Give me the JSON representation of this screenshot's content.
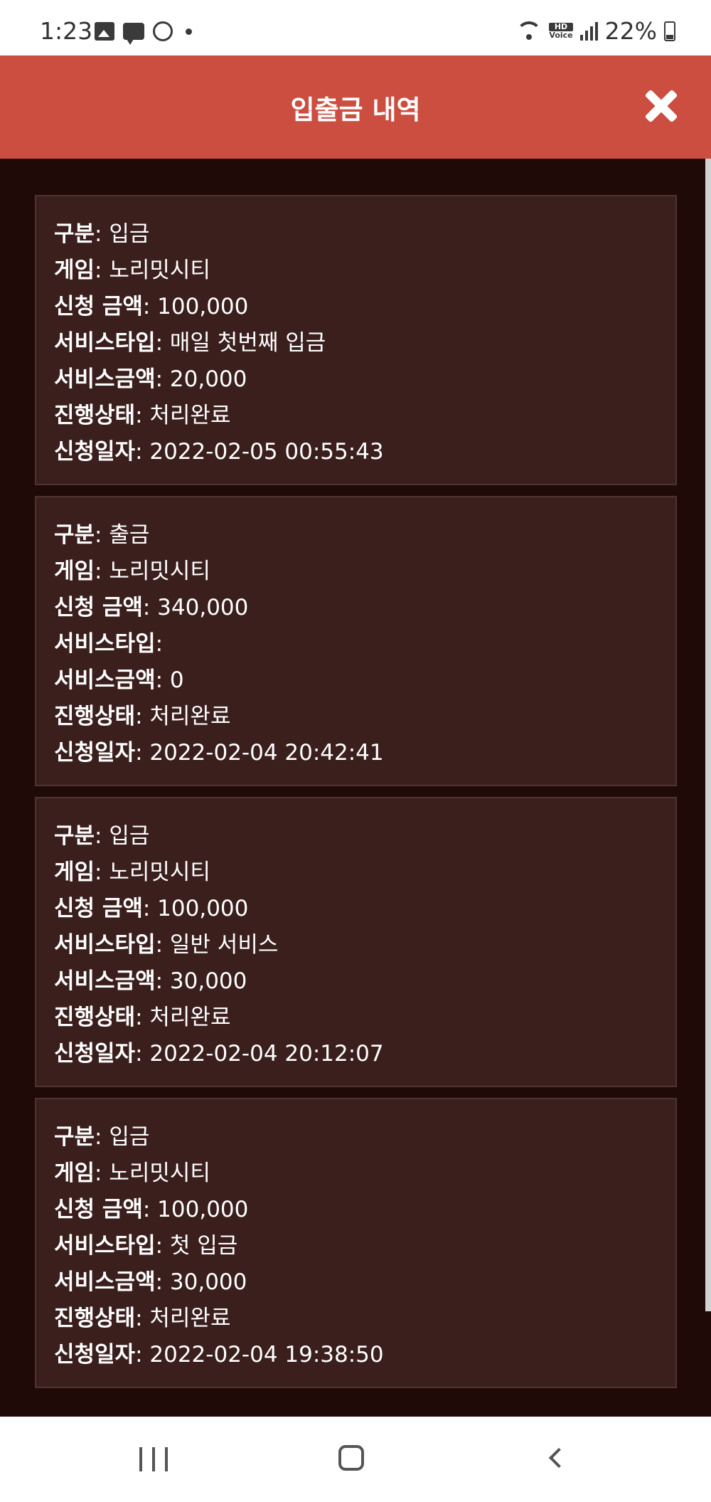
{
  "status_bar": {
    "time": "1:23",
    "battery": "22%",
    "hd_label": "HD",
    "voice_label": "Voice",
    "icons": [
      "image-icon",
      "message-icon",
      "alarm-icon",
      "dot-icon",
      "wifi-icon",
      "hd-voice-icon",
      "signal-icon",
      "battery-icon"
    ]
  },
  "header": {
    "title": "입출금 내역",
    "close_icon": "close-icon"
  },
  "colors": {
    "header_bg": "#cb4e40",
    "page_bg": "#200a08",
    "card_bg": "#3a1f1d",
    "card_border": "#4e3431",
    "text": "#ffffff"
  },
  "labels": {
    "type": "구분",
    "game": "게임",
    "amount": "신청 금액",
    "service_type": "서비스타입",
    "service_amount": "서비스금액",
    "status": "진행상태",
    "date": "신청일자"
  },
  "transactions": [
    {
      "type": ": 입금",
      "game": ": 노리밋시티",
      "amount": ": 100,000",
      "service_type": ": 매일 첫번째 입금",
      "service_amount": ": 20,000",
      "status": ": 처리완료",
      "date": ": 2022-02-05 00:55:43"
    },
    {
      "type": ": 출금",
      "game": ": 노리밋시티",
      "amount": ": 340,000",
      "service_type": ":",
      "service_amount": ": 0",
      "status": ": 처리완료",
      "date": ": 2022-02-04 20:42:41"
    },
    {
      "type": ": 입금",
      "game": ": 노리밋시티",
      "amount": ": 100,000",
      "service_type": ": 일반 서비스",
      "service_amount": ": 30,000",
      "status": ": 처리완료",
      "date": ": 2022-02-04 20:12:07"
    },
    {
      "type": ": 입금",
      "game": ": 노리밋시티",
      "amount": ": 100,000",
      "service_type": ": 첫 입금",
      "service_amount": ": 30,000",
      "status": ": 처리완료",
      "date": ": 2022-02-04 19:38:50"
    }
  ],
  "nav_bar": {
    "icons": [
      "recents-icon",
      "home-icon",
      "back-icon"
    ]
  }
}
